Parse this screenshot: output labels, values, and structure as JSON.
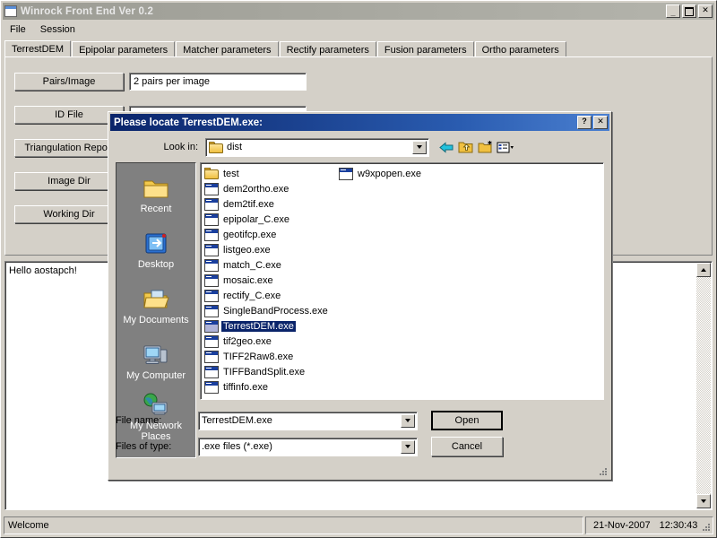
{
  "main_window": {
    "title": "Winrock Front End Ver 0.2",
    "icon": "window-icon",
    "buttons": {
      "minimize": "_",
      "maximize": "□",
      "close": "✕"
    },
    "menu": [
      "File",
      "Session"
    ],
    "tabs": [
      {
        "label": "TerrestDEM",
        "active": true
      },
      {
        "label": "Epipolar parameters",
        "active": false
      },
      {
        "label": "Matcher parameters",
        "active": false
      },
      {
        "label": "Rectify parameters",
        "active": false
      },
      {
        "label": "Fusion parameters",
        "active": false
      },
      {
        "label": "Ortho parameters",
        "active": false
      }
    ],
    "form": {
      "buttons": [
        "Pairs/Image",
        "ID File",
        "Triangulation Report",
        "Image Dir",
        "Working Dir"
      ],
      "fields": [
        {
          "value": "2 pairs per image"
        },
        {
          "value": ""
        }
      ]
    },
    "output": {
      "text": "Hello aostapch!"
    },
    "statusbar": {
      "message": "Welcome",
      "date": "21-Nov-2007",
      "time": "12:30:43"
    }
  },
  "dialog": {
    "title": "Please locate TerrestDEM.exe:",
    "buttons": {
      "help": "?",
      "close": "✕"
    },
    "look_in": {
      "label": "Look in:",
      "value": "dist",
      "icon": "folder-icon",
      "dropdown_icon": "chevron-down-icon"
    },
    "toolbar": [
      {
        "name": "back-icon",
        "glyph": "⬅"
      },
      {
        "name": "up-one-level-icon",
        "glyph": "⬆"
      },
      {
        "name": "new-folder-icon",
        "glyph": "✶"
      },
      {
        "name": "views-icon",
        "glyph": "▤"
      }
    ],
    "places": [
      {
        "label": "Recent",
        "icon": "recent-folder-icon"
      },
      {
        "label": "Desktop",
        "icon": "desktop-icon"
      },
      {
        "label": "My Documents",
        "icon": "my-documents-icon"
      },
      {
        "label": "My Computer",
        "icon": "my-computer-icon"
      },
      {
        "label": "My Network\nPlaces",
        "icon": "my-network-places-icon"
      }
    ],
    "files": [
      {
        "name": "test",
        "type": "folder",
        "selected": false
      },
      {
        "name": "dem2ortho.exe",
        "type": "exe",
        "selected": false
      },
      {
        "name": "dem2tif.exe",
        "type": "exe",
        "selected": false
      },
      {
        "name": "epipolar_C.exe",
        "type": "exe",
        "selected": false
      },
      {
        "name": "geotifcp.exe",
        "type": "exe",
        "selected": false
      },
      {
        "name": "listgeo.exe",
        "type": "exe",
        "selected": false
      },
      {
        "name": "match_C.exe",
        "type": "exe",
        "selected": false
      },
      {
        "name": "mosaic.exe",
        "type": "exe",
        "selected": false
      },
      {
        "name": "rectify_C.exe",
        "type": "exe",
        "selected": false
      },
      {
        "name": "SingleBandProcess.exe",
        "type": "exe",
        "selected": false
      },
      {
        "name": "TerrestDEM.exe",
        "type": "exe",
        "selected": true
      },
      {
        "name": "tif2geo.exe",
        "type": "exe",
        "selected": false
      },
      {
        "name": "TIFF2Raw8.exe",
        "type": "exe",
        "selected": false
      },
      {
        "name": "TIFFBandSplit.exe",
        "type": "exe",
        "selected": false
      },
      {
        "name": "tiffinfo.exe",
        "type": "exe",
        "selected": false
      },
      {
        "name": "w9xpopen.exe",
        "type": "exe",
        "selected": false
      }
    ],
    "file_name": {
      "label": "File name:",
      "value": "TerrestDEM.exe"
    },
    "files_of_type": {
      "label": "Files of type:",
      "value": ".exe files (*.exe)"
    },
    "open_button": "Open",
    "cancel_button": "Cancel"
  },
  "colors": {
    "face": "#d4d0c8",
    "dialog_title_start": "#0a246a",
    "dialog_title_end": "#4a7fd0",
    "selection": "#0a246a",
    "places_bg": "#808080",
    "inactive_title": "#9c9c94"
  }
}
